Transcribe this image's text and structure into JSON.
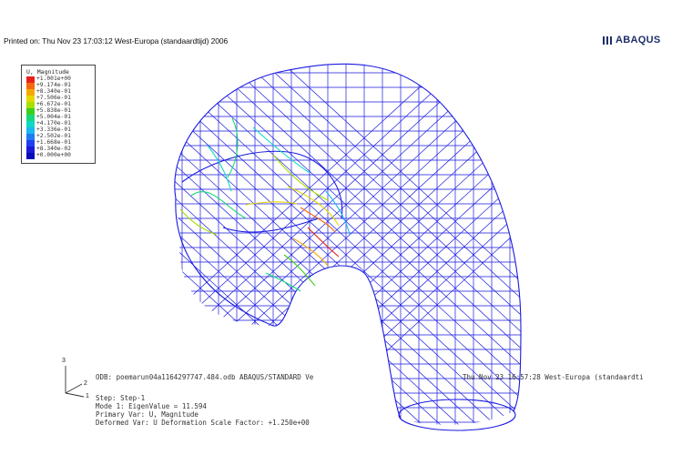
{
  "header": {
    "printed_on": "Printed on: Thu Nov 23 17:03:12 West-Europa (standaardtijd) 2006",
    "logo_text": "ABAQUS"
  },
  "legend": {
    "title": "U, Magnitude",
    "entries": [
      {
        "value": "+1.001e+00",
        "color": "#e8201a"
      },
      {
        "value": "+9.174e-01",
        "color": "#f26a10"
      },
      {
        "value": "+8.340e-01",
        "color": "#f6a800"
      },
      {
        "value": "+7.506e-01",
        "color": "#e6d800"
      },
      {
        "value": "+6.672e-01",
        "color": "#a8e000"
      },
      {
        "value": "+5.838e-01",
        "color": "#3ccf1c"
      },
      {
        "value": "+5.004e-01",
        "color": "#18d87a"
      },
      {
        "value": "+4.170e-01",
        "color": "#10d8c8"
      },
      {
        "value": "+3.336e-01",
        "color": "#18b8f0"
      },
      {
        "value": "+2.502e-01",
        "color": "#1e7cf0"
      },
      {
        "value": "+1.668e-01",
        "color": "#2040f0"
      },
      {
        "value": "+8.340e-02",
        "color": "#1a1ad8"
      },
      {
        "value": "+0.000e+00",
        "color": "#0a0ab8"
      }
    ]
  },
  "info": {
    "odb_line": "ODB: poemarun04a1164297747.484.odb    ABAQUS/STANDARD Ve",
    "version_tail": "Thu Nov 23 16:57:28 West-Europa (standaardti",
    "step": "Step: Step-1",
    "mode": "Mode    1: EigenValue =   11.594",
    "primary_var": "Primary Var: U, Magnitude",
    "deformed_var": "Deformed Var: U   Deformation Scale Factor: +1.250e+00"
  },
  "triad": {
    "axis_3": "3",
    "axis_2": "2",
    "axis_1": "1"
  },
  "colors": {
    "mesh": "#1a1ae0",
    "logo": "#1f2f6b"
  }
}
